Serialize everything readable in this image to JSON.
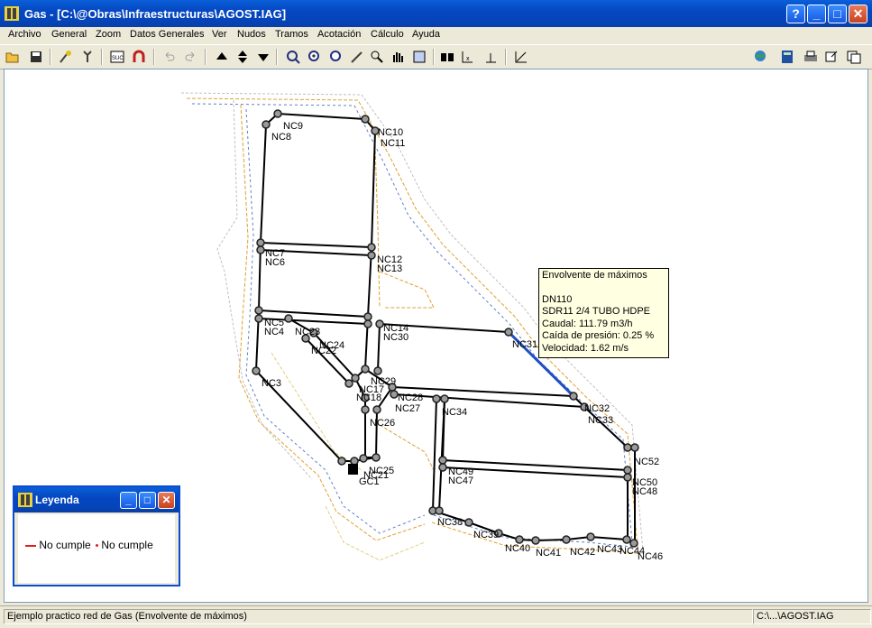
{
  "window": {
    "title": "Gas - [C:\\@Obras\\Infraestructuras\\AGOST.IAG]",
    "help_label": "?",
    "min_label": "_",
    "max_label": "□",
    "close_label": "✕"
  },
  "menu": [
    "Archivo",
    "General",
    "Zoom",
    "Datos Generales",
    "Ver",
    "Nudos",
    "Tramos",
    "Acotación",
    "Cálculo",
    "Ayuda"
  ],
  "toolbar_icons": [
    "open-icon",
    "save-icon",
    "tool-a-icon",
    "tool-b-icon",
    "calc-icon",
    "magnet-icon",
    "undo-icon",
    "redo-icon",
    "up-arrow-icon",
    "updown-arrow-icon",
    "down-arrow-icon",
    "zoom-select-icon",
    "zoom-in-icon",
    "zoom-all-icon",
    "edit-icon",
    "zoom-window-icon",
    "pan-icon",
    "redraw-icon",
    "binoculars-icon",
    "dimension-x-icon",
    "dimension-y-icon",
    "measure-icon",
    "globe-icon",
    "calculator-icon",
    "print-icon",
    "export-icon",
    "window-icon"
  ],
  "tooltip": {
    "title": "Envolvente de máximos",
    "line1": "DN110",
    "line2": "SDR11 2/4 TUBO HDPE",
    "line3": "Caudal: 111.79 m3/h",
    "line4": "Caída de presión: 0.25 %",
    "line5": "Velocidad: 1.62 m/s"
  },
  "legend": {
    "title": "Leyenda",
    "item1": "No cumple",
    "item2": "No cumple",
    "color": "#e02020"
  },
  "status": {
    "left": "Ejemplo practico red de Gas (Envolvente de máximos)",
    "right": "C:\\...\\AGOST.IAG"
  },
  "node_labels": [
    {
      "id": "NC9"
    },
    {
      "id": "NC8"
    },
    {
      "id": "NC10"
    },
    {
      "id": "NC11"
    },
    {
      "id": "NC7"
    },
    {
      "id": "NC6"
    },
    {
      "id": "NC12"
    },
    {
      "id": "NC13"
    },
    {
      "id": "NC5"
    },
    {
      "id": "NC4"
    },
    {
      "id": "NC23"
    },
    {
      "id": "NC24"
    },
    {
      "id": "NC22"
    },
    {
      "id": "NC14"
    },
    {
      "id": "NC30"
    },
    {
      "id": "NC31"
    },
    {
      "id": "NC3"
    },
    {
      "id": "NC29"
    },
    {
      "id": "NC17"
    },
    {
      "id": "NC28"
    },
    {
      "id": "NC18"
    },
    {
      "id": "NC27"
    },
    {
      "id": "NC26"
    },
    {
      "id": "NC34"
    },
    {
      "id": "NC32"
    },
    {
      "id": "NC33"
    },
    {
      "id": "NC52"
    },
    {
      "id": "NC25"
    },
    {
      "id": "NC21"
    },
    {
      "id": "GC1"
    },
    {
      "id": "NC49"
    },
    {
      "id": "NC47"
    },
    {
      "id": "NC50"
    },
    {
      "id": "NC48"
    },
    {
      "id": "NC38"
    },
    {
      "id": "NC39"
    },
    {
      "id": "NC40"
    },
    {
      "id": "NC41"
    },
    {
      "id": "NC42"
    },
    {
      "id": "NC43"
    },
    {
      "id": "NC44"
    },
    {
      "id": "NC46"
    }
  ],
  "colors": {
    "pipe": "#000000",
    "highlight": "#2050c0",
    "contour_orange": "#e0a030",
    "contour_blue": "#6080c0",
    "node": "#808080"
  }
}
